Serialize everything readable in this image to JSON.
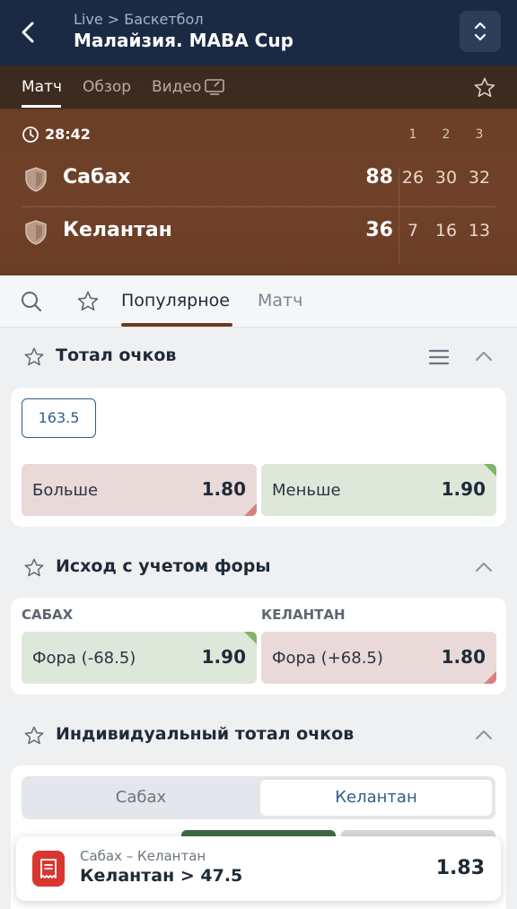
{
  "header": {
    "breadcrumb": "Live > Баскетбол",
    "title": "Малайзия. MABA Cup"
  },
  "top_tabs": {
    "match": "Матч",
    "overview": "Обзор",
    "video": "Видео"
  },
  "scoreboard": {
    "timer": "28:42",
    "quarters": [
      "1",
      "2",
      "3"
    ],
    "teams": [
      {
        "name": "Сабах",
        "score": "88",
        "q": [
          "26",
          "30",
          "32"
        ]
      },
      {
        "name": "Келантан",
        "score": "36",
        "q": [
          "7",
          "16",
          "13"
        ]
      }
    ]
  },
  "nav": {
    "popular": "Популярное",
    "match": "Матч"
  },
  "total_points": {
    "title": "Тотал очков",
    "line": "163.5",
    "over_label": "Больше",
    "over_odd": "1.80",
    "under_label": "Меньше",
    "under_odd": "1.90"
  },
  "handicap": {
    "title": "Исход с учетом форы",
    "team1": "САБАХ",
    "team2": "КЕЛАНТАН",
    "opt1_label": "Фора (-68.5)",
    "opt1_odd": "1.90",
    "opt2_label": "Фора (+68.5)",
    "opt2_odd": "1.80"
  },
  "individual_total": {
    "title": "Индивидуальный тотал очков",
    "seg1": "Сабах",
    "seg2": "Келантан"
  },
  "betslip": {
    "match": "Сабах – Келантан",
    "selection": "Келантан > 47.5",
    "odd": "1.83"
  },
  "colors": {
    "header_bg": "#1b2a44",
    "hero_bg": "#6a3f24",
    "accent_blue": "#2f5d8a",
    "odd_up": "#7fb66b",
    "odd_down": "#d7807e"
  }
}
